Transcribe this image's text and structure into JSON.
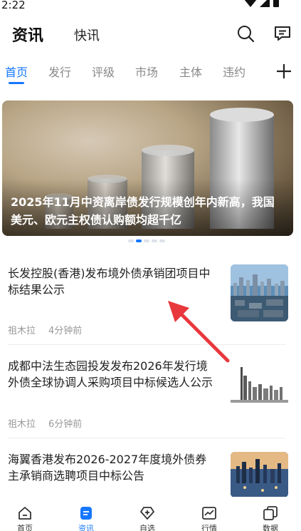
{
  "status_bar": {
    "time": "2:22"
  },
  "header": {
    "main_tab": "资讯",
    "flash_tab": "快讯",
    "search_icon": "search-icon",
    "message_icon": "message-icon"
  },
  "tabs": [
    {
      "label": "首页",
      "active": true
    },
    {
      "label": "发行"
    },
    {
      "label": "评级"
    },
    {
      "label": "市场"
    },
    {
      "label": "主体"
    },
    {
      "label": "违约"
    }
  ],
  "banner": {
    "title": "2025年11月中资离岸债发行规模创年内新高，我国美元、欧元主权债认购额均超千亿",
    "page_count": 5,
    "active_page": 2
  },
  "news": [
    {
      "title": "长发控股(香港)发布境外债承销团项目中标结果公示",
      "author": "祖木拉",
      "time": "4分钟前"
    },
    {
      "title": "成都中法生态园投发发布2026年发行境外债全球协调人采购项目中标候选人公示",
      "author": "祖木拉",
      "time": "6分钟前"
    },
    {
      "title": "海翼香港发布2026-2027年度境外债券主承销商选聘项目中标公告",
      "author": "",
      "time": ""
    }
  ],
  "bottom_nav": [
    {
      "label": "首页",
      "icon": "home-icon"
    },
    {
      "label": "资讯",
      "icon": "news-icon",
      "active": true
    },
    {
      "label": "自选",
      "icon": "watchlist-icon"
    },
    {
      "label": "行情",
      "icon": "market-chart-icon"
    },
    {
      "label": "数据",
      "icon": "data-icon"
    }
  ],
  "colors": {
    "accent": "#1677ff",
    "annotation_arrow": "#e8383d"
  }
}
